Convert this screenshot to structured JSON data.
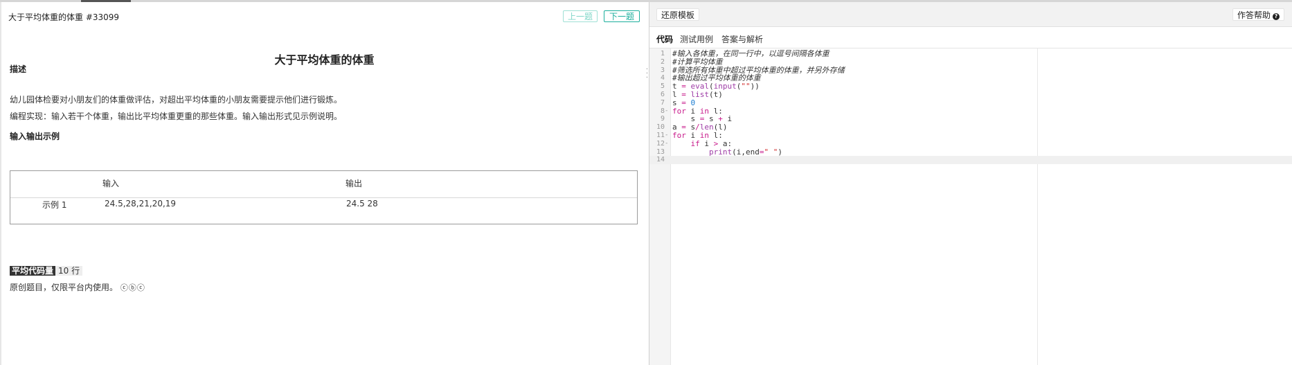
{
  "left": {
    "problem_title": "大于平均体重的体重 #33099",
    "prev_label": "上一题",
    "next_label": "下一题",
    "headline": "大于平均体重的体重",
    "desc_label": "描述",
    "desc_p1": "幼儿园体检要对小朋友们的体重做评估，对超出平均体重的小朋友需要提示他们进行锻炼。",
    "desc_p2": "编程实现：输入若干个体重，输出比平均体重更重的那些体重。输入输出形式见示例说明。",
    "io_label": "输入输出示例",
    "table": {
      "col_input": "输入",
      "col_output": "输出",
      "row_label": "示例 1",
      "input_value": "24.5,28,21,20,19",
      "output_value": "24.5 28"
    },
    "avg_label": "平均代码量",
    "avg_value": "10 行",
    "license_text": "原创题目，仅限平台内使用。",
    "license_icons": "ⓒⓑⓒ"
  },
  "right": {
    "restore_label": "还原模板",
    "help_label": "作答帮助",
    "help_icon": "?",
    "tabs": [
      "代码",
      "测试用例",
      "答案与解析"
    ],
    "code_lines": [
      "#输入各体重，在同一行中，以逗号间隔各体重",
      "#计算平均体重",
      "#筛选所有体重中超过平均体重的体重，并另外存储",
      "#输出超过平均体重的体重",
      "t = eval(input(\"\"))",
      "l = list(t)",
      "s = 0",
      "for i in l:",
      "    s = s + i",
      "a = s/len(l)",
      "for i in l:",
      "    if i > a:",
      "        print(i,end=\" \")",
      ""
    ],
    "line_numbers": [
      "1",
      "2",
      "3",
      "4",
      "5",
      "6",
      "7",
      "8",
      "9",
      "10",
      "11",
      "12",
      "13",
      "14"
    ]
  },
  "colors": {
    "accent": "#1aae9c",
    "accent_light": "#7fd6c8",
    "comment": "#8c8c8c",
    "keyword": "#c81a8b",
    "number": "#1a7bd0",
    "string": "#d12f2f"
  }
}
